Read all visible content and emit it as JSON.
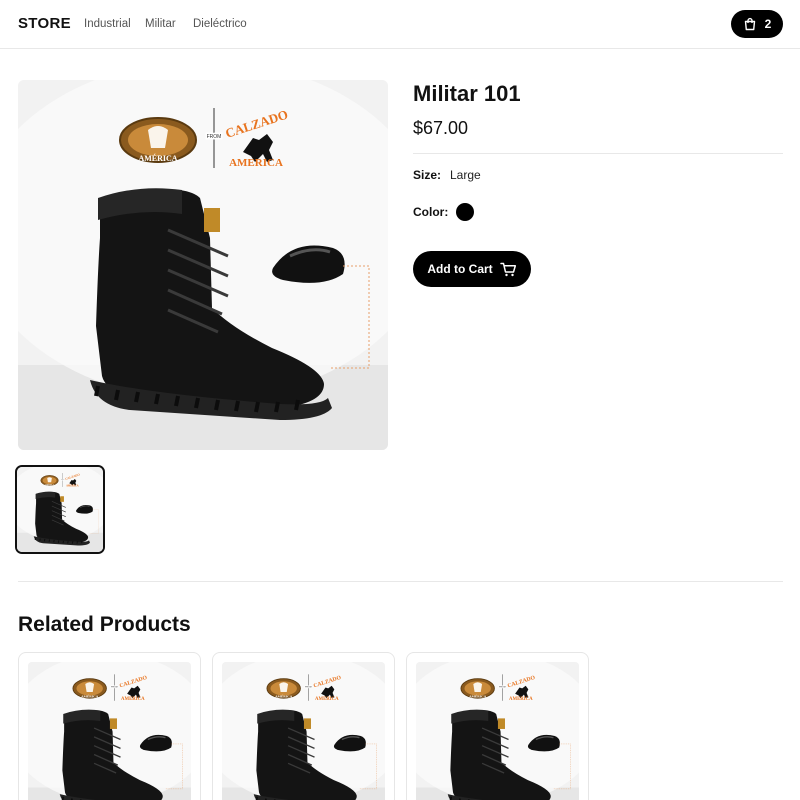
{
  "header": {
    "logo": "STORE",
    "nav": [
      "Industrial",
      "Militar",
      "Dieléctrico"
    ],
    "cart_count": "2"
  },
  "product": {
    "title": "Militar 101",
    "price": "$67.00",
    "size_label": "Size:",
    "size_value": "Large",
    "color_label": "Color:",
    "color_value": "#000000",
    "add_to_cart": "Add to Cart",
    "image_brand": {
      "badge_text": "AMÉRICA",
      "from_text": "FROM",
      "wordmark_top": "CALZADO",
      "wordmark_bottom": "AMÉRICA"
    }
  },
  "related": {
    "title": "Related Products",
    "items": [
      {},
      {},
      {}
    ]
  },
  "icons": {
    "cart": "shopping-bag-icon",
    "add_to_cart": "shopping-cart-icon"
  },
  "colors": {
    "accent": "#000000",
    "brand_orange": "#e8731e",
    "badge_brown": "#8a5a1e"
  }
}
